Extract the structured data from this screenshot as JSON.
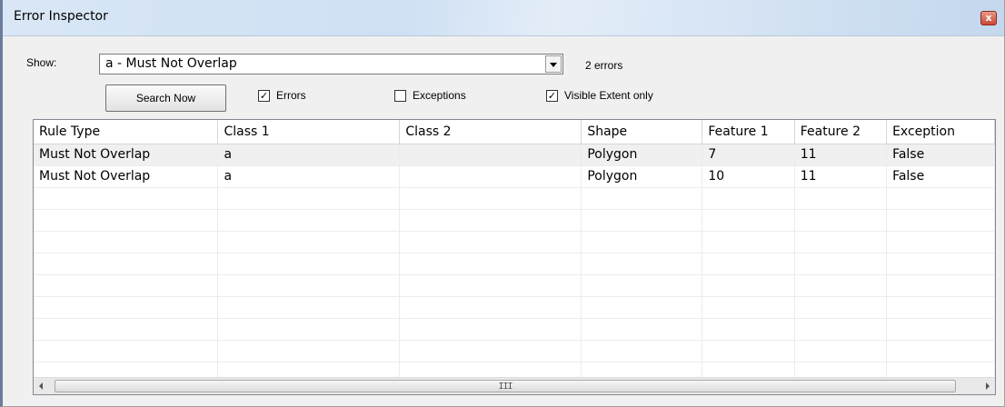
{
  "window": {
    "title": "Error Inspector",
    "close_label": "x"
  },
  "filter": {
    "show_label": "Show:",
    "selected_rule": "a - Must Not Overlap",
    "error_count": "2 errors"
  },
  "controls": {
    "search_label": "Search Now",
    "errors_label": "Errors",
    "errors_checked": true,
    "exceptions_label": "Exceptions",
    "exceptions_checked": false,
    "visible_extent_label": "Visible Extent only",
    "visible_extent_checked": true
  },
  "table": {
    "columns": [
      "Rule Type",
      "Class 1",
      "Class 2",
      "Shape",
      "Feature 1",
      "Feature 2",
      "Exception"
    ],
    "rows": [
      [
        "Must Not Overlap",
        "a",
        "",
        "Polygon",
        "7",
        "11",
        "False"
      ],
      [
        "Must Not Overlap",
        "a",
        "",
        "Polygon",
        "10",
        "11",
        "False"
      ]
    ]
  },
  "scrollbar": {
    "grip": "III"
  }
}
